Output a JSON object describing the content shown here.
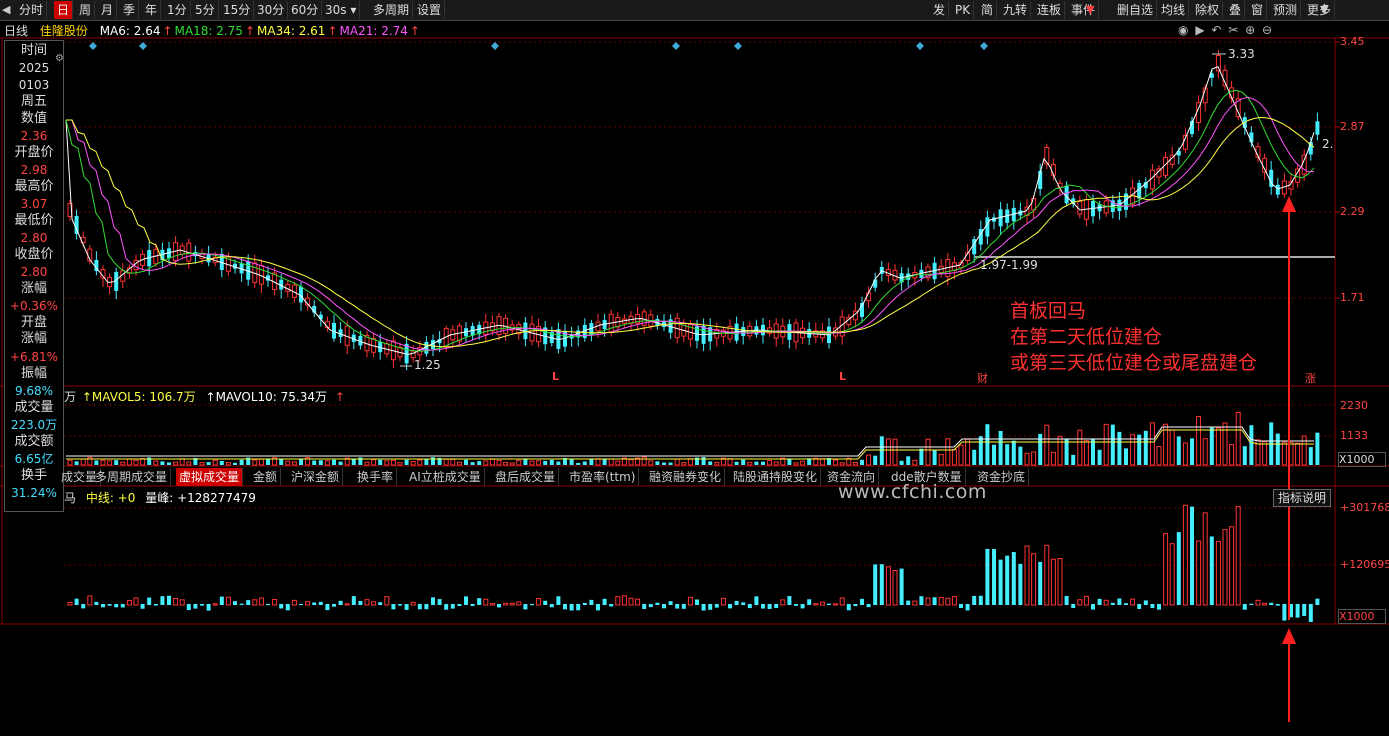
{
  "toolbar": {
    "left_items": [
      "分时",
      "日",
      "周",
      "月",
      "季",
      "年",
      "1分",
      "5分",
      "15分",
      "30分",
      "60分",
      "30s",
      "多周期",
      "设置"
    ],
    "active_item": "日",
    "right_items": [
      "发",
      "PK",
      "简",
      "九转",
      "连板",
      "事件",
      "删自选",
      "均线",
      "除权",
      "叠",
      "窗",
      "预测",
      "更多"
    ]
  },
  "header": {
    "period": "日线",
    "stock_name": "佳隆股份",
    "ma": [
      {
        "label": "MA6: 2.64",
        "color": "#ffffff"
      },
      {
        "label": "MA18: 2.75",
        "color": "#33dd33"
      },
      {
        "label": "MA34: 2.61",
        "color": "#ffff44"
      },
      {
        "label": "MA21: 2.74",
        "color": "#ff55ff"
      }
    ]
  },
  "sidepanel": [
    {
      "label": "时间",
      "value": null
    },
    {
      "label": "2025",
      "value": null
    },
    {
      "label": "0103",
      "value": null
    },
    {
      "label": "周五",
      "value": null
    },
    {
      "label": "数值",
      "value": "2.36",
      "color": "#ff4444"
    },
    {
      "label": "开盘价",
      "value": "2.98",
      "color": "#ff4444"
    },
    {
      "label": "最高价",
      "value": "3.07",
      "color": "#ff4444"
    },
    {
      "label": "最低价",
      "value": "2.80",
      "color": "#ff4444"
    },
    {
      "label": "收盘价",
      "value": "2.80",
      "color": "#ff4444"
    },
    {
      "label": "涨幅",
      "value": "+0.36%",
      "color": "#ff4444"
    },
    {
      "label": "开盘涨幅",
      "value": "+6.81%",
      "color": "#ff4444"
    },
    {
      "label": "振幅",
      "value": "9.68%",
      "color": "#44ddff"
    },
    {
      "label": "成交量",
      "value": "223.0万",
      "color": "#44ddff"
    },
    {
      "label": "成交额",
      "value": "6.65亿",
      "color": "#44ddff"
    },
    {
      "label": "换手",
      "value": "31.24%",
      "color": "#44ddff"
    }
  ],
  "price_axis": [
    "3.45",
    "2.87",
    "2.29",
    "1.71"
  ],
  "price_labels": {
    "high": "3.33",
    "low": "1.25",
    "range": "1.97-1.99",
    "right_partial": "2."
  },
  "markers": {
    "L1": "L",
    "L2": "L",
    "cai": "财",
    "zhang": "涨"
  },
  "volume": {
    "unit": "万",
    "mavol5": "MAVOL5: 106.7万",
    "mavol10": "MAVOL10: 75.34万",
    "axis": [
      "2230",
      "1133",
      "X1000"
    ]
  },
  "bottom_tabs": [
    "成交量",
    "多周期成交量",
    "虚拟成交量",
    "金额",
    "沪深金额",
    "换手率",
    "AI立桩成交量",
    "盘后成交量",
    "市盈率(ttm)",
    "融资融券变化",
    "陆股通持股变化",
    "资金流向",
    "dde散户数量",
    "资金抄底"
  ],
  "active_tab": "虚拟成交量",
  "indicator": {
    "legend_prefix": "马",
    "line": "中线: +0",
    "peak": "量峰: +128277479",
    "axis": [
      "+301768",
      "+120695",
      "X1000"
    ],
    "help": "指标说明"
  },
  "watermark": "www.cfchi.com",
  "annotation": [
    "首板回马",
    "在第二天低位建仓",
    "或第三天低位建仓或尾盘建仓"
  ],
  "colors": {
    "up": "#ff3333",
    "down": "#44eeff",
    "annotation": "#ff3030"
  }
}
